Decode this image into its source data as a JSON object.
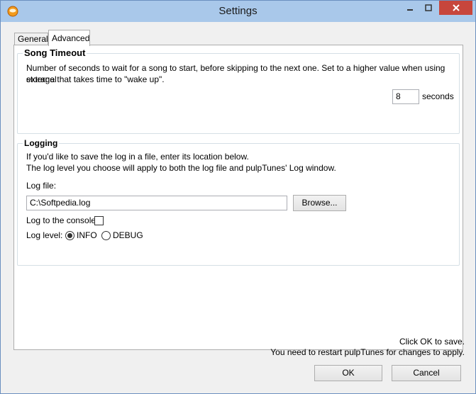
{
  "window": {
    "title": "Settings"
  },
  "tabs": [
    {
      "label": "General"
    },
    {
      "label": "Advanced"
    }
  ],
  "song_timeout": {
    "title": "Song Timeout",
    "description_line1": "Number of seconds to wait for a song to start, before skipping to the next one. Set to a higher value when using external",
    "description_line2": "storage that takes time to \"wake up\".",
    "value": "8",
    "unit": "seconds"
  },
  "logging": {
    "title": "Logging",
    "description_line1": "If you'd like to save the log in a file, enter its location below.",
    "description_line2": "The log level you choose will apply to both the log file and pulpTunes' Log window.",
    "log_file_label": "Log file:",
    "log_file_value": "C:\\Softpedia.log",
    "browse_label": "Browse...",
    "console_label": "Log to the console:",
    "level_label": "Log level:",
    "levels": [
      {
        "label": "INFO",
        "selected": true
      },
      {
        "label": "DEBUG",
        "selected": false
      }
    ]
  },
  "footer": {
    "line1": "Click OK to save.",
    "line2": "You need to restart pulpTunes for changes to apply.",
    "ok_label": "OK",
    "cancel_label": "Cancel"
  },
  "colors": {
    "titlebar": "#a9c8ea",
    "close_button": "#c7463c"
  }
}
